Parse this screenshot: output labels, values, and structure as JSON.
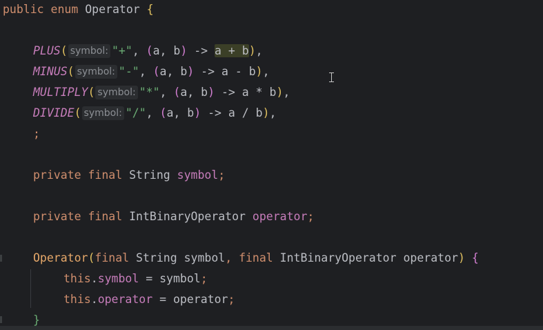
{
  "code": {
    "l1": {
      "public": "public",
      "enum": "enum",
      "name": "Operator",
      "brace": "{"
    },
    "plus": {
      "name": "PLUS",
      "hint": "symbol:",
      "str": "\"+\"",
      "a": "a",
      "b": "b",
      "arrow": " -> ",
      "expr": "a + b"
    },
    "minus": {
      "name": "MINUS",
      "hint": "symbol:",
      "str": "\"-\"",
      "a": "a",
      "b": "b",
      "arrow": " -> ",
      "expr": "a - b"
    },
    "multiply": {
      "name": "MULTIPLY",
      "hint": "symbol:",
      "str": "\"*\"",
      "a": "a",
      "b": "b",
      "arrow": " -> ",
      "expr": "a * b"
    },
    "divide": {
      "name": "DIVIDE",
      "hint": "symbol:",
      "str": "\"/\"",
      "a": "a",
      "b": "b",
      "arrow": " -> ",
      "expr": "a / b"
    },
    "semi": ";",
    "f1": {
      "private": "private",
      "final": "final",
      "type": "String",
      "name": "symbol"
    },
    "f2": {
      "private": "private",
      "final": "final",
      "type": "IntBinaryOperator",
      "name": "operator"
    },
    "ctor": {
      "name": "Operator",
      "final1": "final",
      "type1": "String",
      "p1": "symbol",
      "final2": "final",
      "type2": "IntBinaryOperator",
      "p2": "operator"
    },
    "s1": {
      "this": "this",
      "field": "symbol",
      "value": "symbol"
    },
    "s2": {
      "this": "this",
      "field": "operator",
      "value": "operator"
    },
    "close": "}"
  }
}
